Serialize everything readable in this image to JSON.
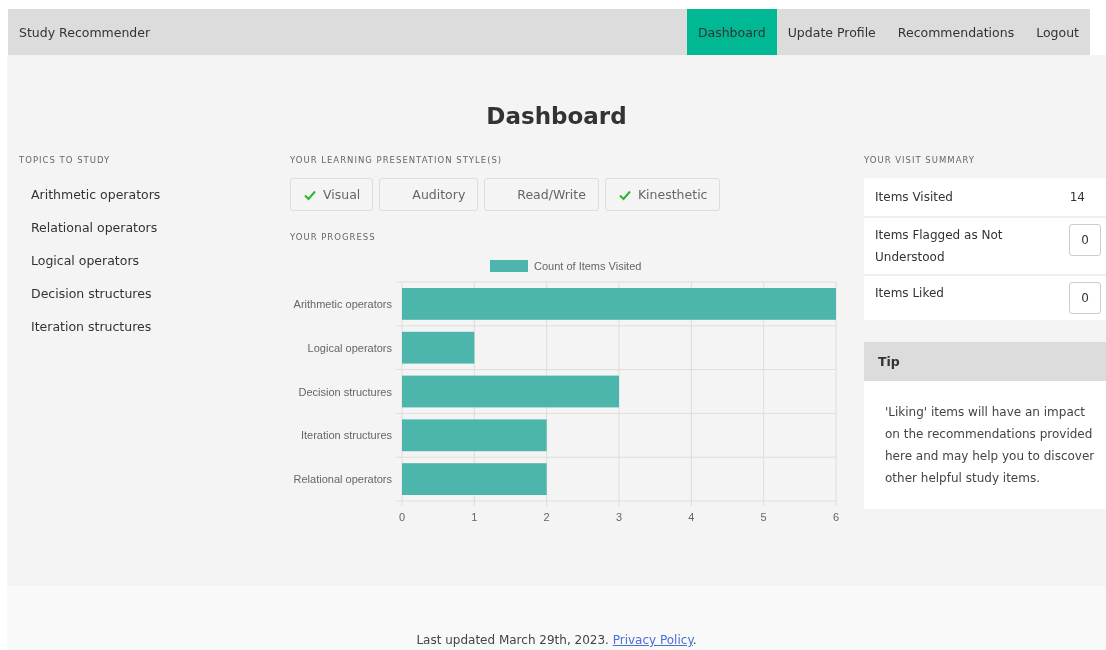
{
  "navbar": {
    "brand": "Study Recommender",
    "links": [
      {
        "label": "Dashboard",
        "selected": true
      },
      {
        "label": "Update Profile",
        "selected": false
      },
      {
        "label": "Recommendations",
        "selected": false
      },
      {
        "label": "Logout",
        "selected": false
      }
    ]
  },
  "page_title": "Dashboard",
  "topics": {
    "heading": "TOPICS TO STUDY",
    "items": [
      "Arithmetic operators",
      "Relational operators",
      "Logical operators",
      "Decision structures",
      "Iteration structures"
    ]
  },
  "styles": {
    "heading": "YOUR LEARNING PRESENTATION STYLE(S)",
    "options": [
      {
        "label": "Visual",
        "checked": true
      },
      {
        "label": "Auditory",
        "checked": false
      },
      {
        "label": "Read/Write",
        "checked": false
      },
      {
        "label": "Kinesthetic",
        "checked": true
      }
    ]
  },
  "progress": {
    "heading": "YOUR PROGRESS",
    "chart_data": {
      "type": "bar",
      "orientation": "horizontal",
      "categories": [
        "Arithmetic operators",
        "Logical operators",
        "Decision structures",
        "Iteration structures",
        "Relational operators"
      ],
      "series": [
        {
          "name": "Count of Items Visited",
          "color": "#4db6ac",
          "values": [
            6,
            1,
            3,
            2,
            2
          ]
        }
      ],
      "xlim": [
        0,
        6
      ],
      "xticks": [
        0,
        1,
        2,
        3,
        4,
        5,
        6
      ],
      "grid": true
    }
  },
  "summary": {
    "heading": "YOUR VISIT SUMMARY",
    "rows": [
      {
        "label": "Items Visited",
        "value": "14",
        "kind": "text"
      },
      {
        "label": "Items Flagged as Not Understood",
        "value": "0",
        "kind": "box"
      },
      {
        "label": "Items Liked",
        "value": "0",
        "kind": "box"
      }
    ]
  },
  "tip": {
    "title": "Tip",
    "body": "'Liking' items will have an impact on the recommendations provided here and may help you to discover other helpful study items."
  },
  "footer": {
    "text": "Last updated March 29th, 2023.",
    "link": "Privacy Policy",
    "after": "."
  }
}
